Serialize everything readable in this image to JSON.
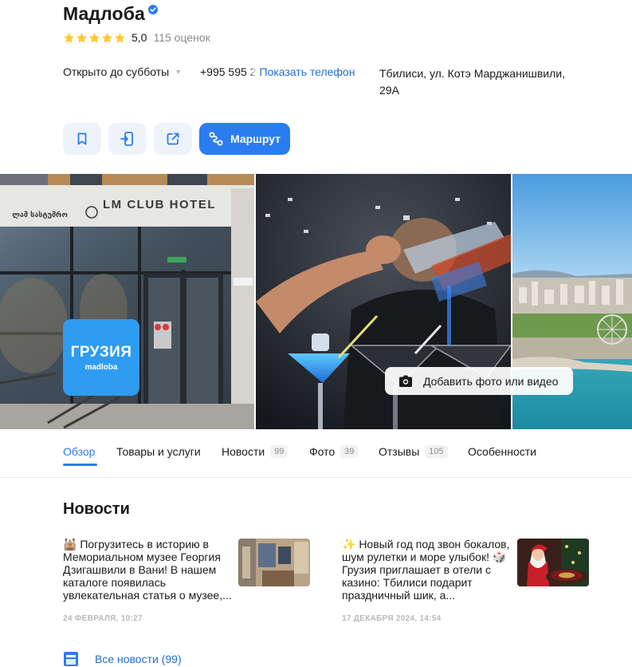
{
  "org": {
    "name": "Мадлоба",
    "rating": "5,0",
    "reviews_count": "115 оценок",
    "stars": 5
  },
  "info": {
    "hours": "Открыто до субботы",
    "phone_partial": "+995 595 2",
    "show_phone": "Показать телефон",
    "address": "Тбилиси, ул. Котэ Марджанишвили, 29А"
  },
  "actions": {
    "route_label": "Маршрут"
  },
  "gallery": {
    "hotel_sign": "LM CLUB HOTEL",
    "hotel_sign_georgian": "ლამ სასტუმრო",
    "brand_tile_big": "ГРУЗИЯ",
    "brand_tile_small": "madloba",
    "add_photo_label": "Добавить фото или видео"
  },
  "tabs": [
    {
      "label": "Обзор",
      "count": null,
      "active": true
    },
    {
      "label": "Товары и услуги",
      "count": null,
      "active": false
    },
    {
      "label": "Новости",
      "count": "99",
      "active": false
    },
    {
      "label": "Фото",
      "count": "39",
      "active": false
    },
    {
      "label": "Отзывы",
      "count": "105",
      "active": false
    },
    {
      "label": "Особенности",
      "count": null,
      "active": false
    }
  ],
  "news": {
    "section_title": "Новости",
    "items": [
      {
        "text": "🕍 Погрузитесь в историю в Мемориальном музее Георгия Дзигашвили в Вани! В нашем каталоге появилась увлекательная статья о музее,...",
        "date": "24 ФЕВРАЛЯ, 10:27"
      },
      {
        "text": "✨ Новый год под звон бокалов, шум рулетки и море улыбок! 🎲 Грузия приглашает в отели с казино: Тбилиси подарит праздничный шик, а...",
        "date": "17 ДЕКАБРЯ 2024, 14:54"
      }
    ],
    "all_news_label": "Все новости (99)"
  },
  "colors": {
    "accent": "#2a7cf0",
    "link": "#1f6fd1",
    "star": "#fcc934",
    "verified": "#2a7cf0"
  }
}
